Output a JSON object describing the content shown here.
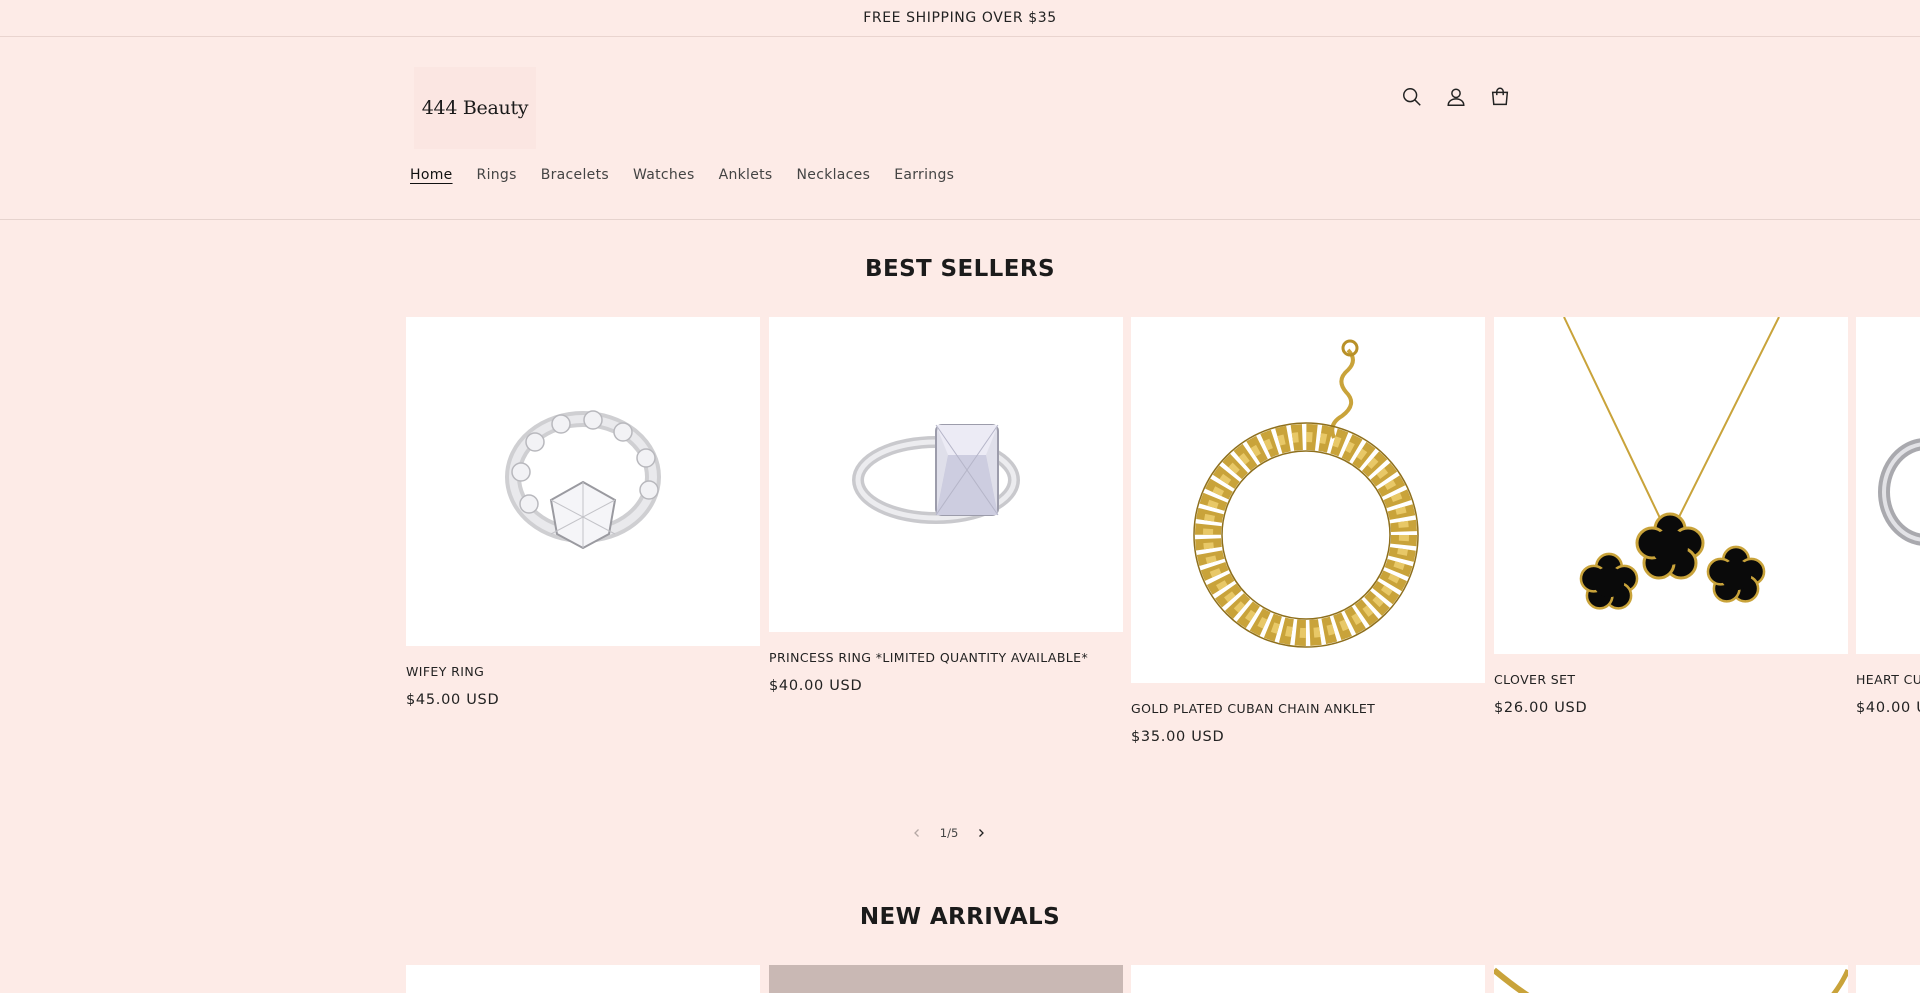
{
  "announcement": "FREE SHIPPING OVER $35",
  "logo": "444 Beauty",
  "header_icons": [
    "search-icon",
    "account-icon",
    "cart-icon"
  ],
  "nav": {
    "items": [
      "Home",
      "Rings",
      "Bracelets",
      "Watches",
      "Anklets",
      "Necklaces",
      "Earrings"
    ]
  },
  "best_sellers": {
    "title": "BEST SELLERS",
    "products": [
      {
        "title": "WIFEY RING",
        "price": "$45.00 USD"
      },
      {
        "title": "PRINCESS RING *LIMITED QUANTITY AVAILABLE*",
        "price": "$40.00 USD"
      },
      {
        "title": "GOLD PLATED CUBAN CHAIN ANKLET",
        "price": "$35.00 USD"
      },
      {
        "title": "CLOVER SET",
        "price": "$26.00 USD"
      },
      {
        "title": "HEART CU",
        "price": "$40.00 U"
      }
    ],
    "pagination": {
      "current": "1",
      "total": "5",
      "separator": "/"
    }
  },
  "new_arrivals": {
    "title": "NEW ARRIVALS"
  },
  "colors": {
    "background": "#fdebe7",
    "text": "#1f1f1f",
    "gold": "#c9a33a"
  }
}
